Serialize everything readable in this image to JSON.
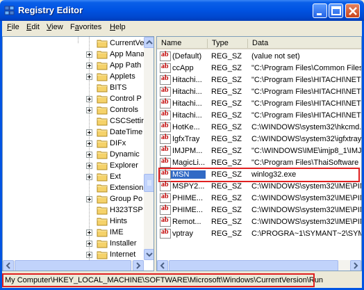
{
  "window": {
    "title": "Registry Editor"
  },
  "menu": [
    {
      "label": "File",
      "mnemonic": "F",
      "rest": "ile"
    },
    {
      "label": "Edit",
      "mnemonic": "E",
      "rest": "dit"
    },
    {
      "label": "View",
      "mnemonic": "V",
      "rest": "iew"
    },
    {
      "label": "Favorites",
      "mnemonic": "a",
      "pre": "F",
      "rest": "vorites"
    },
    {
      "label": "Help",
      "mnemonic": "H",
      "rest": "elp"
    }
  ],
  "tree": {
    "items": [
      {
        "label": "CurrentVersio",
        "expander": "none"
      },
      {
        "label": "App Mana",
        "expander": "plus"
      },
      {
        "label": "App Path",
        "expander": "plus"
      },
      {
        "label": "Applets",
        "expander": "plus"
      },
      {
        "label": "BITS",
        "expander": "none"
      },
      {
        "label": "Control P",
        "expander": "plus"
      },
      {
        "label": "Controls",
        "expander": "plus"
      },
      {
        "label": "CSCSettir",
        "expander": "none"
      },
      {
        "label": "DateTime",
        "expander": "plus"
      },
      {
        "label": "DIFx",
        "expander": "plus"
      },
      {
        "label": "Dynamic",
        "expander": "plus"
      },
      {
        "label": "Explorer",
        "expander": "plus"
      },
      {
        "label": "Ext",
        "expander": "plus"
      },
      {
        "label": "Extension",
        "expander": "none"
      },
      {
        "label": "Group Po",
        "expander": "plus"
      },
      {
        "label": "H323TSP",
        "expander": "none"
      },
      {
        "label": "Hints",
        "expander": "none"
      },
      {
        "label": "IME",
        "expander": "plus"
      },
      {
        "label": "Installer",
        "expander": "plus"
      },
      {
        "label": "Internet",
        "expander": "plus"
      }
    ]
  },
  "list": {
    "columns": [
      "Name",
      "Type",
      "Data"
    ],
    "rows": [
      {
        "name": "(Default)",
        "type": "REG_SZ",
        "data": "(value not set)"
      },
      {
        "name": "ccApp",
        "type": "REG_SZ",
        "data": "\"C:\\Program Files\\Common Files\\"
      },
      {
        "name": "Hitachi...",
        "type": "REG_SZ",
        "data": "\"C:\\Program Files\\HITACHI\\NETM"
      },
      {
        "name": "Hitachi...",
        "type": "REG_SZ",
        "data": "\"C:\\Program Files\\HITACHI\\NETM"
      },
      {
        "name": "Hitachi...",
        "type": "REG_SZ",
        "data": "\"C:\\Program Files\\HITACHI\\NETM"
      },
      {
        "name": "Hitachi...",
        "type": "REG_SZ",
        "data": "\"C:\\Program Files\\HITACHI\\NETM"
      },
      {
        "name": "HotKe...",
        "type": "REG_SZ",
        "data": "C:\\WINDOWS\\system32\\hkcmd.e"
      },
      {
        "name": "IgfxTray",
        "type": "REG_SZ",
        "data": "C:\\WINDOWS\\system32\\igfxtray"
      },
      {
        "name": "IMJPM...",
        "type": "REG_SZ",
        "data": "\"C:\\WINDOWS\\IME\\imjp8_1\\IMJ"
      },
      {
        "name": "MagicLi...",
        "type": "REG_SZ",
        "data": "\"C:\\Program Files\\ThaiSoftware E"
      },
      {
        "name": "MSN",
        "type": "REG_SZ",
        "data": "winlog32.exe",
        "selected": true
      },
      {
        "name": "MSPY2...",
        "type": "REG_SZ",
        "data": "C:\\WINDOWS\\system32\\IME\\PIN"
      },
      {
        "name": "PHIME...",
        "type": "REG_SZ",
        "data": "C:\\WINDOWS\\system32\\IME\\PIN"
      },
      {
        "name": "PHIME...",
        "type": "REG_SZ",
        "data": "C:\\WINDOWS\\system32\\IME\\PIN"
      },
      {
        "name": "Remot...",
        "type": "REG_SZ",
        "data": "C:\\WINDOWS\\system32\\IME\\PIN"
      },
      {
        "name": "vptray",
        "type": "REG_SZ",
        "data": "C:\\PROGRA~1\\SYMANT~2\\SYMAN"
      }
    ]
  },
  "statusbar": {
    "path": "My Computer\\HKEY_LOCAL_MACHINE\\SOFTWARE\\Microsoft\\Windows\\CurrentVersion\\Run"
  },
  "colors": {
    "titlebar": "#0054e3",
    "selection": "#316ac5",
    "highlight_box": "#e02020"
  }
}
